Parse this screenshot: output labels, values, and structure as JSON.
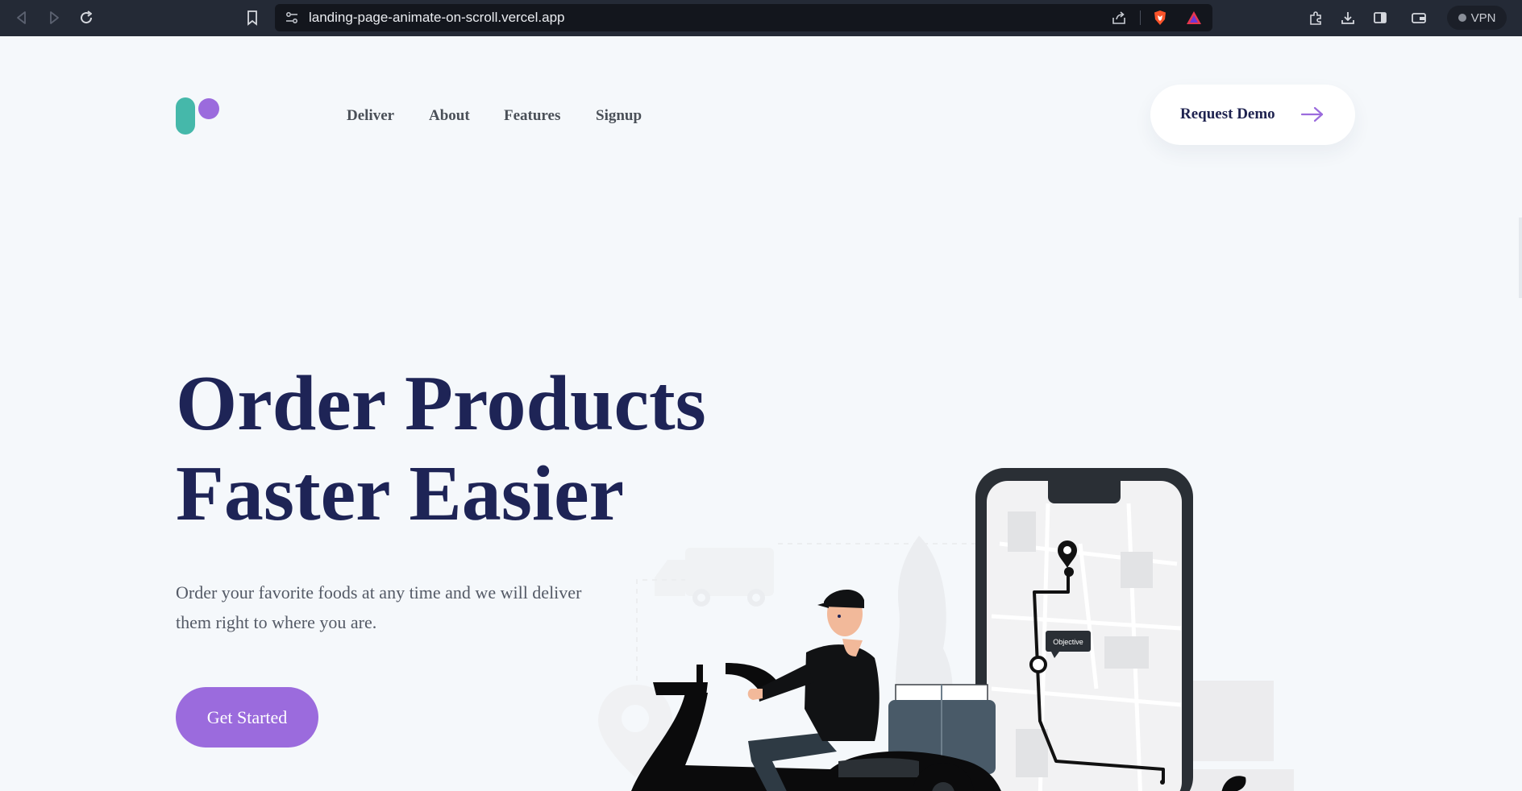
{
  "browser": {
    "url": "landing-page-animate-on-scroll.vercel.app",
    "vpn_label": "VPN"
  },
  "nav": {
    "links": [
      "Deliver",
      "About",
      "Features",
      "Signup"
    ],
    "demo_label": "Request Demo"
  },
  "hero": {
    "title_line1": "Order Products",
    "title_line2": "Faster Easier",
    "subtitle": "Order your favorite foods at any time and we will deliver them right to where you are.",
    "cta_label": "Get Started"
  },
  "illustration": {
    "map_tooltip": "Objective"
  },
  "colors": {
    "brand_purple": "#9b6bdd",
    "brand_teal": "#45b8aa",
    "heading_navy": "#1e2456",
    "page_bg": "#f5f8fb",
    "chrome_bg": "#242a36"
  }
}
